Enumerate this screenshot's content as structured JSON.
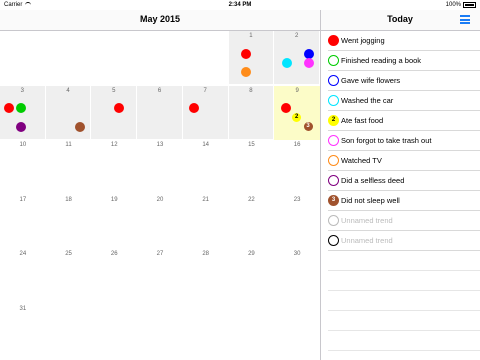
{
  "status_bar": {
    "carrier": "Carrier",
    "time": "2:34 PM",
    "battery": "100%"
  },
  "header": {
    "month_title": "May 2015",
    "panel_title": "Today",
    "menu_icon": "hamburger-menu-icon"
  },
  "calendar": {
    "days": [
      {
        "n": "1",
        "greyed": true,
        "dots": [
          [
            "#ff0000",
            ""
          ],
          [
            "#ff8c1a",
            ""
          ]
        ]
      },
      {
        "n": "2",
        "greyed": true,
        "dots": [
          [
            "#0000ff",
            ""
          ],
          [
            "#00e5ff",
            ""
          ],
          [
            "#ff33ff",
            ""
          ]
        ]
      },
      {
        "n": "3",
        "greyed": true,
        "dots": [
          [
            "#ff0000",
            ""
          ],
          [
            "#00cc00",
            ""
          ],
          [
            "#800080",
            ""
          ]
        ]
      },
      {
        "n": "4",
        "greyed": true,
        "dots": [
          [
            "#a0522d",
            ""
          ]
        ]
      },
      {
        "n": "5",
        "greyed": true,
        "dots": [
          [
            "#ff0000",
            ""
          ]
        ]
      },
      {
        "n": "6",
        "greyed": true,
        "dots": []
      },
      {
        "n": "7",
        "greyed": true,
        "dots": [
          [
            "#ff0000",
            ""
          ]
        ]
      },
      {
        "n": "8",
        "greyed": true,
        "dots": []
      },
      {
        "n": "9",
        "today": true,
        "dots": [
          [
            "#ff0000",
            ""
          ],
          [
            "#ffff00",
            "2"
          ],
          [
            "#a0522d",
            "3"
          ]
        ]
      },
      {
        "n": "10"
      },
      {
        "n": "11"
      },
      {
        "n": "12"
      },
      {
        "n": "13"
      },
      {
        "n": "14"
      },
      {
        "n": "15"
      },
      {
        "n": "16"
      },
      {
        "n": "17"
      },
      {
        "n": "18"
      },
      {
        "n": "19"
      },
      {
        "n": "20"
      },
      {
        "n": "21"
      },
      {
        "n": "22"
      },
      {
        "n": "23"
      },
      {
        "n": "24"
      },
      {
        "n": "25"
      },
      {
        "n": "26"
      },
      {
        "n": "27"
      },
      {
        "n": "28"
      },
      {
        "n": "29"
      },
      {
        "n": "30"
      },
      {
        "n": "31"
      }
    ]
  },
  "trends": [
    {
      "label": "Went jogging",
      "color": "#ff0000",
      "filled": true,
      "count": ""
    },
    {
      "label": "Finished reading a book",
      "color": "#00cc00",
      "filled": false,
      "count": ""
    },
    {
      "label": "Gave wife flowers",
      "color": "#0000ff",
      "filled": false,
      "count": ""
    },
    {
      "label": "Washed the car",
      "color": "#00e5ff",
      "filled": false,
      "count": ""
    },
    {
      "label": "Ate fast food",
      "color": "#ffff00",
      "filled": true,
      "count": "2"
    },
    {
      "label": "Son forgot to take trash out",
      "color": "#ff33ff",
      "filled": false,
      "count": ""
    },
    {
      "label": "Watched TV",
      "color": "#ff8c1a",
      "filled": false,
      "count": ""
    },
    {
      "label": "Did a selfless deed",
      "color": "#800080",
      "filled": false,
      "count": ""
    },
    {
      "label": "Did not sleep well",
      "color": "#a0522d",
      "filled": true,
      "count": "3"
    },
    {
      "label": "Unnamed trend",
      "color": "#bbbbbb",
      "filled": false,
      "count": "",
      "muted": true
    },
    {
      "label": "Unnamed trend",
      "color": "#000000",
      "filled": false,
      "count": "",
      "muted": true
    }
  ]
}
